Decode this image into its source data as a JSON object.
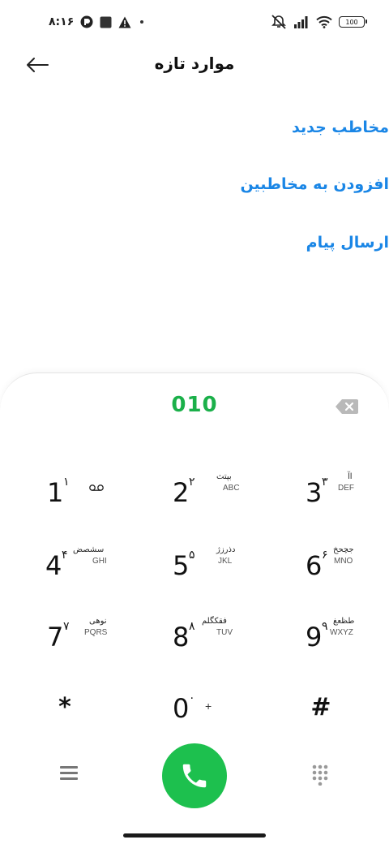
{
  "status_bar": {
    "time": "۸:۱۶",
    "battery": "100",
    "icons": [
      "app-icon",
      "square-icon",
      "warning-icon",
      "dot-icon",
      "mute-icon",
      "signal-icon",
      "wifi-icon",
      "battery-icon"
    ]
  },
  "header": {
    "title": "موارد تازه",
    "back_icon": "arrow-left-icon"
  },
  "options": [
    {
      "label": "مخاطب جدید"
    },
    {
      "label": "افزودن به مخاطبین"
    },
    {
      "label": "ارسال پیام"
    }
  ],
  "dialpad": {
    "number": "010",
    "backspace_icon": "backspace-icon",
    "keys": [
      {
        "digit": "1",
        "pdigit": "۱",
        "fa": "",
        "lat": ""
      },
      {
        "digit": "2",
        "pdigit": "۲",
        "fa": "بپتث",
        "lat": "ABC"
      },
      {
        "digit": "3",
        "pdigit": "۳",
        "fa": "اآ",
        "lat": "DEF"
      },
      {
        "digit": "4",
        "pdigit": "۴",
        "fa": "سشصض",
        "lat": "GHI"
      },
      {
        "digit": "5",
        "pdigit": "۵",
        "fa": "دذرزژ",
        "lat": "JKL"
      },
      {
        "digit": "6",
        "pdigit": "۶",
        "fa": "جچحخ",
        "lat": "MNO"
      },
      {
        "digit": "7",
        "pdigit": "۷",
        "fa": "نوهی",
        "lat": "PQRS"
      },
      {
        "digit": "8",
        "pdigit": "۸",
        "fa": "فقکگلم",
        "lat": "TUV"
      },
      {
        "digit": "9",
        "pdigit": "۹",
        "fa": "طظعغ",
        "lat": "WXYZ"
      }
    ],
    "star": "*",
    "zero": {
      "digit": "0",
      "pdigit": "۰",
      "plus": "+"
    },
    "hash": "#",
    "voicemail_icon": "voicemail-icon"
  },
  "bottom_bar": {
    "menu_icon": "menu-icon",
    "call_icon": "phone-icon",
    "dialpad_icon": "dialpad-grid-icon",
    "colors": {
      "call": "#1dc04e",
      "number": "#1bb04a",
      "links": "#1a86e6"
    }
  }
}
